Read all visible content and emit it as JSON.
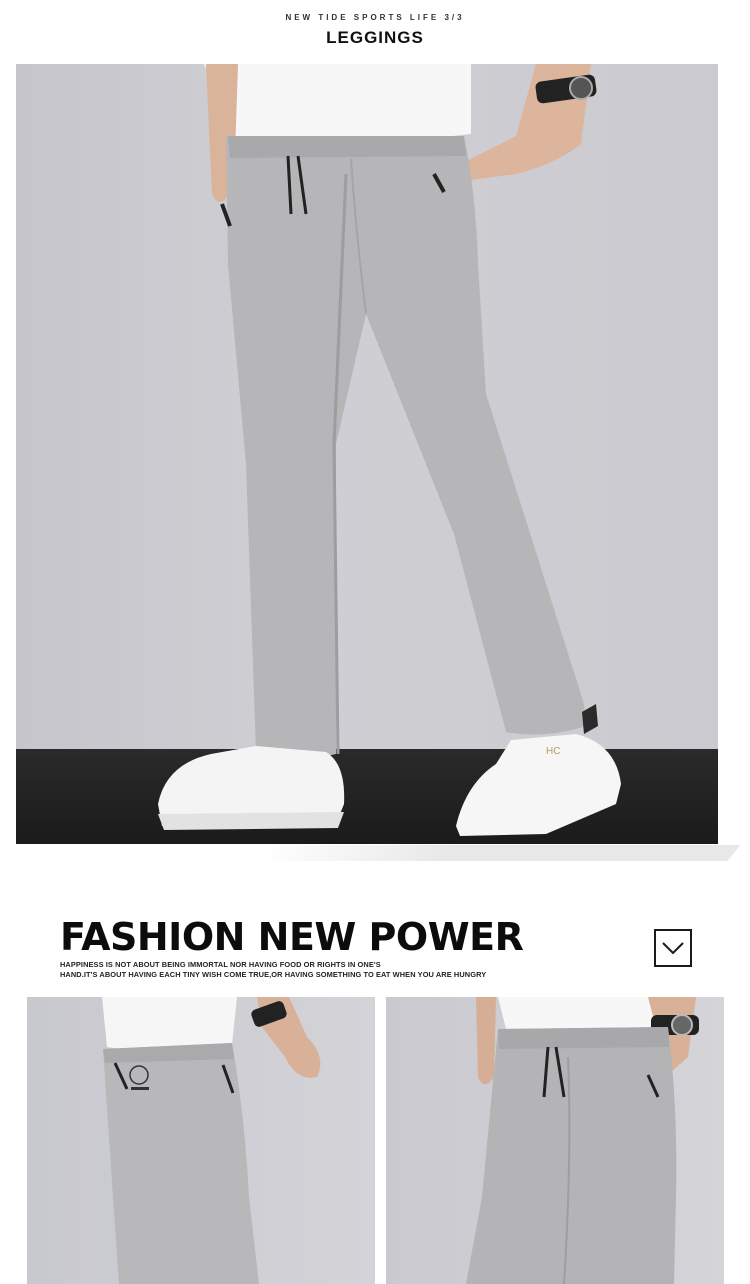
{
  "header": {
    "subtitle": "NEW TIDE SPORTS LIFE 3/3",
    "title": "LEGGINGS"
  },
  "hero": {
    "photo_icon": "model-wearing-grey-pants-photo",
    "sneaker_logo": "HC"
  },
  "fashion": {
    "title": "FASHION NEW POWER",
    "tagline_line1": "HAPPINESS IS NOT ABOUT BEING IMMORTAL NOR HAVING FOOD OR RIGHTS IN ONE'S",
    "tagline_line2": "HAND.IT'S ABOUT HAVING EACH TINY WISH COME TRUE,OR HAVING SOMETHING TO EAT WHEN YOU ARE HUNGRY",
    "scroll_icon": "chevron-down-icon"
  },
  "details": {
    "left_icon": "pocket-detail-photo",
    "right_icon": "drawstring-detail-photo"
  },
  "colors": {
    "pants": "#b4b4b6",
    "background": "#cacad0",
    "floor": "#1e1e1e"
  }
}
